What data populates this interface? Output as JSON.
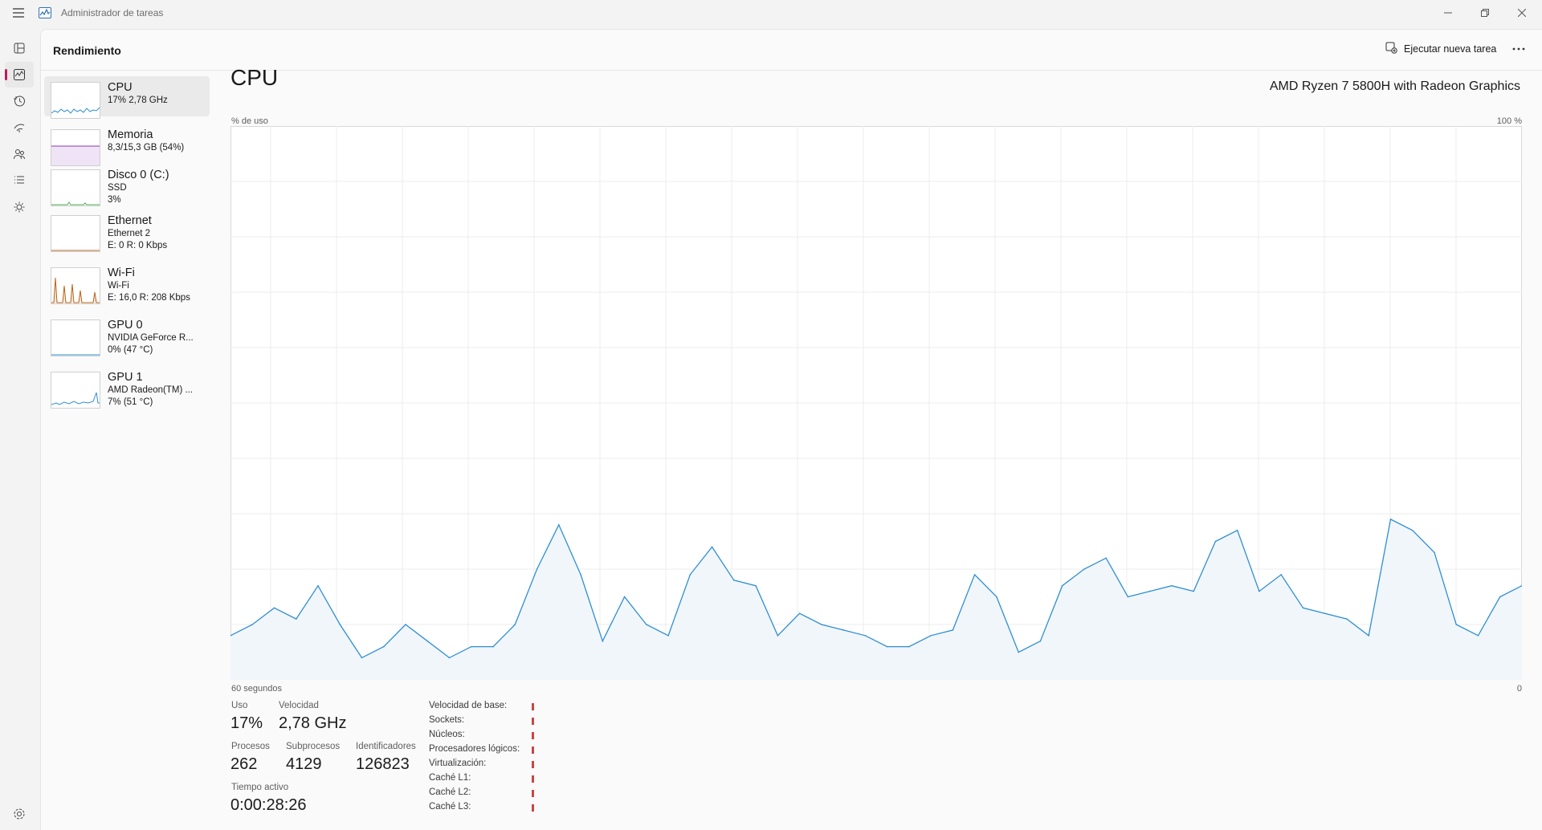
{
  "window": {
    "title": "Administrador de tareas",
    "controls": [
      "minimize-icon",
      "restore-icon",
      "close-icon"
    ]
  },
  "nav_rail": {
    "items": [
      {
        "icon": "processes-icon"
      },
      {
        "icon": "performance-icon",
        "active": true
      },
      {
        "icon": "app-history-icon"
      },
      {
        "icon": "startup-apps-icon"
      },
      {
        "icon": "users-icon"
      },
      {
        "icon": "details-icon"
      },
      {
        "icon": "services-icon"
      }
    ],
    "settings_icon": "gear-icon"
  },
  "header": {
    "title": "Rendimiento",
    "run_task_label": "Ejecutar nueva tarea",
    "run_task_icon": "new-task-icon",
    "more_icon": "more-icon"
  },
  "devices": [
    {
      "name": "CPU",
      "line2": "17% 2,78 GHz",
      "line3": "",
      "color": "#2f8fd2",
      "active": true
    },
    {
      "name": "Memoria",
      "line2": "8,3/15,3 GB (54%)",
      "line3": "",
      "color": "#8e3ab8"
    },
    {
      "name": "Disco 0 (C:)",
      "line2": "SSD",
      "line3": "3%",
      "color": "#4caf50"
    },
    {
      "name": "Ethernet",
      "line2": "Ethernet 2",
      "line3": "E: 0 R: 0 Kbps",
      "color": "#b8651b"
    },
    {
      "name": "Wi-Fi",
      "line2": "Wi-Fi",
      "line3": "E: 16,0 R: 208 Kbps",
      "color": "#b8651b"
    },
    {
      "name": "GPU 0",
      "line2": "NVIDIA GeForce R...",
      "line3": "0% (47 °C)",
      "color": "#2f8fd2"
    },
    {
      "name": "GPU 1",
      "line2": "AMD Radeon(TM) ...",
      "line3": "7% (51 °C)",
      "color": "#2f8fd2"
    }
  ],
  "cpu": {
    "title": "CPU",
    "model": "AMD Ryzen 7 5800H with Radeon Graphics",
    "y_axis_label": "% de uso",
    "y_axis_max": "100 %",
    "x_axis_left": "60 segundos",
    "x_axis_right": "0",
    "line_color": "#2f8fd2",
    "fill_color": "#f1f6fb",
    "chart_data": {
      "type": "area",
      "ylim": [
        0,
        100
      ],
      "values": [
        8,
        10,
        13,
        11,
        17,
        10,
        4,
        6,
        10,
        7,
        4,
        6,
        6,
        10,
        20,
        28,
        19,
        7,
        15,
        10,
        8,
        19,
        24,
        18,
        17,
        8,
        12,
        10,
        9,
        8,
        6,
        6,
        8,
        9,
        19,
        15,
        5,
        7,
        17,
        20,
        22,
        15,
        16,
        17,
        16,
        25,
        27,
        16,
        19,
        13,
        12,
        11,
        8,
        29,
        27,
        23,
        10,
        8,
        15,
        17
      ]
    },
    "stats": {
      "uso_label": "Uso",
      "uso": "17%",
      "velocidad_label": "Velocidad",
      "velocidad": "2,78 GHz",
      "procesos_label": "Procesos",
      "procesos": "262",
      "subprocesos_label": "Subprocesos",
      "subprocesos": "4129",
      "identificadores_label": "Identificadores",
      "identificadores": "126823",
      "tiempo_label": "Tiempo activo",
      "tiempo": "0:00:28:26"
    },
    "specs": [
      "Velocidad de base:",
      "Sockets:",
      "Núcleos:",
      "Procesadores lógicos:",
      "Virtualización:",
      "Caché L1:",
      "Caché L2:",
      "Caché L3:"
    ]
  }
}
